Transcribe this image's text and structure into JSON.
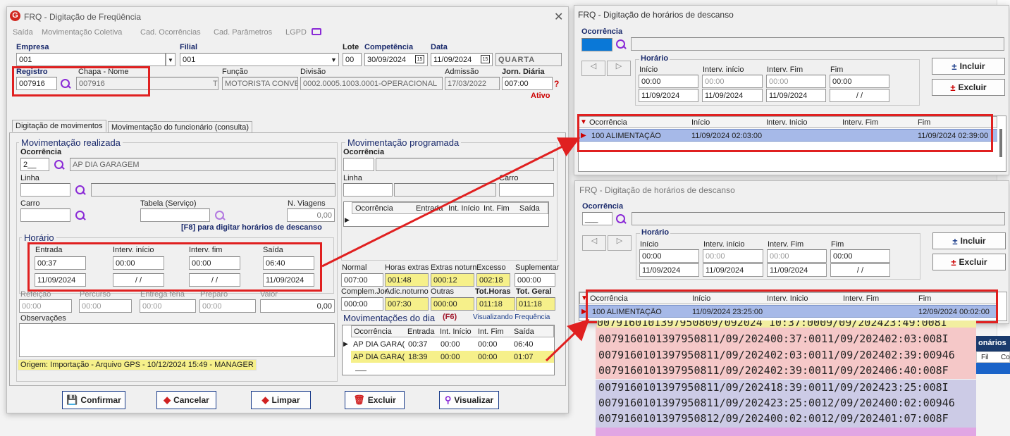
{
  "main": {
    "title": "FRQ - Digitação de Freqüência",
    "menu": [
      "Saída",
      "Movimentação Coletiva",
      "Cad. Ocorrências",
      "Cad. Parâmetros",
      "LGPD"
    ],
    "empresa_label": "Empresa",
    "empresa_value": "001",
    "filial_label": "Filial",
    "filial_value": "001",
    "lote_label": "Lote",
    "lote_value": "00",
    "competencia_label": "Competência",
    "competencia_value": "30/09/2024",
    "data_label": "Data",
    "data_value": "11/09/2024",
    "weekday": "QUARTA",
    "registro_label": "Registro",
    "registro_value": "007916",
    "chapa_label": "Chapa  -  Nome",
    "chapa_value": "007916",
    "chapa_suffix": "T",
    "funcao_label": "Função",
    "funcao_value": "MOTORISTA CONVE",
    "divisao_label": "Divisão",
    "divisao_value": "0002.0005.1003.0001-OPERACIONAL",
    "admissao_label": "Admissão",
    "admissao_value": "17/03/2022",
    "jorn_label": "Jorn. Diária",
    "jorn_value": "007:00",
    "status": "Ativo",
    "tabs": [
      "Digitação de movimentos",
      "Movimentação do funcionário (consulta)"
    ],
    "realizada": {
      "title": "Movimentação realizada",
      "ocorrencia_label": "Ocorrência",
      "ocorrencia_code": "2__",
      "ocorrencia_desc": "AP DIA GARAGEM",
      "linha_label": "Linha",
      "carro_label": "Carro",
      "tabela_label": "Tabela (Serviço)",
      "viagens_label": "N. Viagens",
      "viagens_value": "0,00",
      "f8_hint": "[F8] para digitar horários de descanso",
      "horario_title": "Horário",
      "entrada_label": "Entrada",
      "entrada_time": "00:37",
      "entrada_date": "11/09/2024",
      "interv_ini_label": "Interv. início",
      "interv_ini_time": "00:00",
      "interv_ini_date": "/ /",
      "interv_fim_label": "Interv. fim",
      "interv_fim_time": "00:00",
      "interv_fim_date": "/ /",
      "saida_label": "Saída",
      "saida_time": "06:40",
      "saida_date": "11/09/2024",
      "refeicao_label": "Refeição",
      "refeicao_value": "00:00",
      "percurso_label": "Percurso",
      "percurso_value": "00:00",
      "entrega_label": "Entrega féria",
      "entrega_value": "00:00",
      "preparo_label": "Preparo",
      "preparo_value": "00:00",
      "valor_label": "Valor",
      "valor_value": "0,00",
      "obs_label": "Observações",
      "origem": "Origem: Importação - Arquivo GPS - 10/12/2024 15:49 - MANAGER"
    },
    "programada": {
      "title": "Movimentação programada",
      "ocorrencia_label": "Ocorrência",
      "linha_label": "Linha",
      "carro_label": "Carro",
      "grid_headers": [
        "Ocorrência",
        "Entrada",
        "Int. Início",
        "Int. Fim",
        "Saída"
      ]
    },
    "totals": {
      "normal_label": "Normal",
      "normal": "007:00",
      "extras_label": "Horas extras",
      "extras": "001:48",
      "noturn_label": "Extras noturn.",
      "noturn": "000:12",
      "excesso_label": "Excesso",
      "excesso": "002:18",
      "suplementar_label": "Suplementar",
      "suplementar": "000:00",
      "complem_label": "Complem.Jor.",
      "complem": "000:00",
      "adic_label": "Adic.noturno",
      "adic": "007:30",
      "outras_label": "Outras",
      "outras": "000:00",
      "tothoras_label": "Tot.Horas",
      "tothoras": "011:18",
      "totgeral_label": "Tot. Geral",
      "totgeral": "011:18"
    },
    "dia": {
      "title": "Movimentações do dia",
      "key": "(F6)",
      "status": "Visualizando Frequência",
      "headers": [
        "Ocorrência",
        "Entrada",
        "Int. Início",
        "Int. Fim",
        "Saída"
      ],
      "rows": [
        [
          "AP DIA GARA(",
          "00:37",
          "00:00",
          "00:00",
          "06:40"
        ],
        [
          "AP DIA GARA(",
          "18:39",
          "00:00",
          "00:00",
          "01:07"
        ]
      ]
    },
    "buttons": [
      "Confirmar",
      "Cancelar",
      "Limpar",
      "Excluir",
      "Visualizar"
    ]
  },
  "dlg1": {
    "title": "FRQ - Digitação de horários de descanso",
    "ocorrencia_label": "Ocorrência",
    "horario_label": "Horário",
    "inicio_label": "Início",
    "inicio": "00:00",
    "inicio_date": "11/09/2024",
    "ivi_label": "Interv. início",
    "ivi": "00:00",
    "ivi_date": "11/09/2024",
    "ivf_label": "Interv. Fim",
    "ivf": "00:00",
    "ivf_date": "11/09/2024",
    "fim_label": "Fim",
    "fim": "00:00",
    "fim_date": "/ /",
    "incluir": "Incluir",
    "excluir": "Excluir",
    "headers": [
      "Ocorrência",
      "Início",
      "Interv. Inicio",
      "Interv. Fim",
      "Fim"
    ],
    "row": [
      "100 ALIMENTAÇÃO",
      "11/09/2024 02:03:00",
      "",
      "",
      "11/09/2024 02:39:00"
    ]
  },
  "dlg2": {
    "title": "FRQ - Digitação de horários de descanso",
    "ocorrencia_label": "Ocorrência",
    "ocorrencia_value": "___",
    "horario_label": "Horário",
    "inicio_label": "Início",
    "inicio": "00:00",
    "inicio_date": "11/09/2024",
    "ivi_label": "Interv. início",
    "ivi": "00:00",
    "ivi_date": "11/09/2024",
    "ivf_label": "Interv. Fim",
    "ivf": "00:00",
    "ivf_date": "11/09/2024",
    "fim_label": "Fim",
    "fim": "00:00",
    "fim_date": "/ /",
    "incluir": "Incluir",
    "excluir": "Excluir",
    "headers": [
      "Ocorrência",
      "Início",
      "Interv. Inicio",
      "Interv. Fim",
      "Fim"
    ],
    "row": [
      "100 ALIMENTAÇÃO",
      "11/09/2024 23:25:00",
      "",
      "",
      "12/09/2024 00:02:00"
    ]
  },
  "textfile": {
    "lines_pink": [
      "007916010139795​0809/0​92024 10:37:0009/09/202423:49:008I",
      "007916010139795​0811/09/202400:37:0011/09/202402:03:008I",
      "007916010139795​0811/09/202402:03:0011/09/202402:39:00946",
      "007916010139795​0811/09/202402:39:0011/09/202406:40:008F"
    ],
    "lines_purple": [
      "007916010139795​0811/09/202418:39:0011/09/202423:25:008I",
      "007916010139795​0811/09/202423:25:0012/09/202400:02:00946",
      "007916010139795​0812/09/202400:02:0012/09/202401:07:008F"
    ],
    "side_label": "onários",
    "side_cols": [
      "Fil",
      "Co"
    ]
  }
}
